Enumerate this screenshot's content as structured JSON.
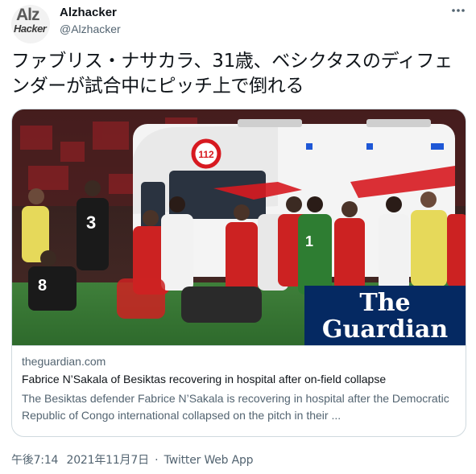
{
  "author": {
    "avatar_line1": "Alz",
    "avatar_line2": "Hacker",
    "display_name": "Alzhacker",
    "handle": "@Alzhacker"
  },
  "tweet": {
    "text": "ファブリス・ナサカラ、31歳、ベシクタスのディフェンダーが試合中にピッチ上で倒れる"
  },
  "card": {
    "image_alt": "Ambulance and players on the pitch",
    "watermark_line1": "The",
    "watermark_line2": "Guardian",
    "ambulance_number": "112",
    "jersey_3": "3",
    "jersey_8": "8",
    "jersey_1": "1",
    "domain": "theguardian.com",
    "title": "Fabrice N’Sakala of Besiktas recovering in hospital after on-field collapse",
    "description": "The Besiktas defender Fabrice N’Sakala is recovering in hospital after the Democratic Republic of Congo international collapsed on the pitch in their ..."
  },
  "meta": {
    "time": "午後7:14",
    "separator": "·",
    "date": "2021年11月7日",
    "source": "Twitter Web App"
  },
  "colors": {
    "text_primary": "#0f1419",
    "text_secondary": "#536471",
    "border": "#cfd9de",
    "guardian_blue": "#052962",
    "ambulance_red": "#d71920"
  },
  "icons": {
    "more": "more-horizontal-icon"
  }
}
